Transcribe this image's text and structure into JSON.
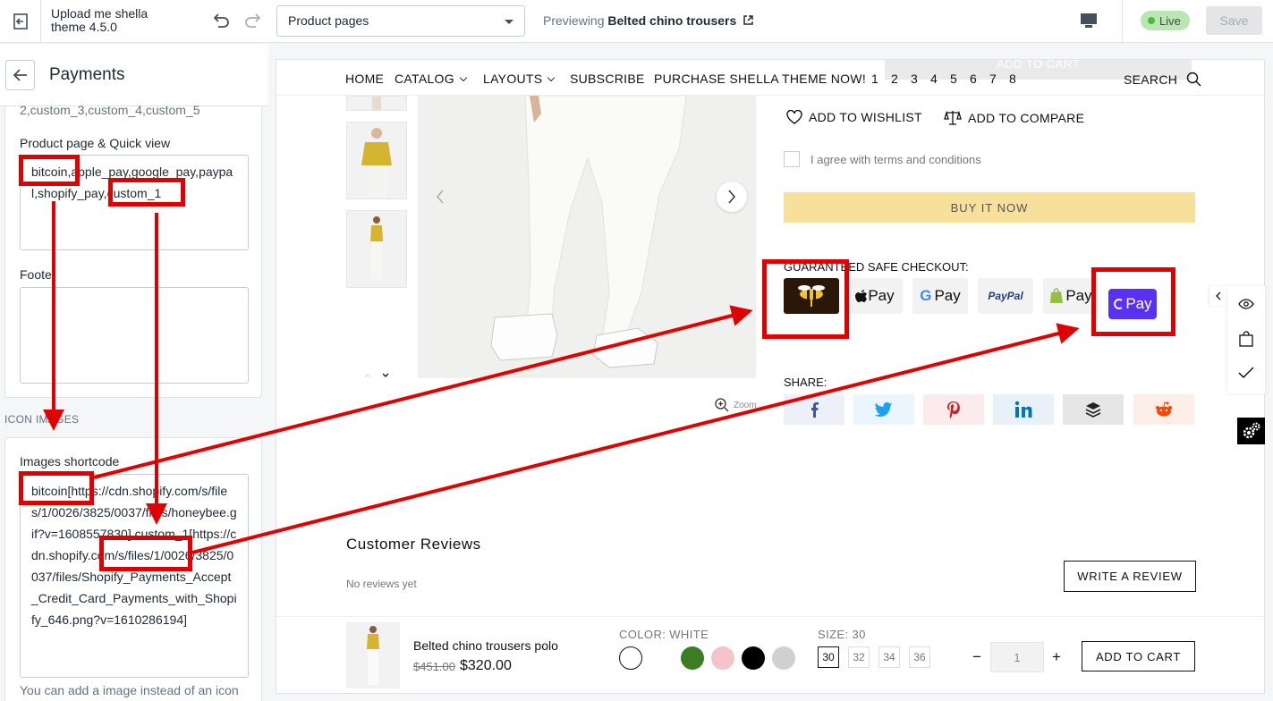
{
  "topbar": {
    "theme_name": "Upload me shella theme 4.5.0",
    "page_select": "Product pages",
    "previewing_prefix": "Previewing",
    "previewing_product": "Belted chino trousers",
    "live_label": "Live",
    "save_label": "Save"
  },
  "sidebar": {
    "title": "Payments",
    "cut_text": "2,custom_3,custom_4,custom_5",
    "product_label": "Product page & Quick view",
    "product_value": "bitcoin,apple_pay,google_pay,paypal,shopify_pay,custom_1",
    "footer_label": "Footer",
    "icon_images_heading": "ICON IMAGES",
    "shortcode_label": "Images shortcode",
    "shortcode_value": "bitcoin[https://cdn.shopify.com/s/files/1/0026/3825/0037/files/honeybee.gif?v=1608557830],custom_1[https://cdn.shopify.com/s/files/1/0026/3825/0037/files/Shopify_Payments_Accept_Credit_Card_Payments_with_Shopify_646.png?v=1610286194]",
    "help_text": "You can add a image instead of an icon"
  },
  "store": {
    "nav": [
      "HOME",
      "CATALOG",
      "LAYOUTS",
      "SUBSCRIBE",
      "PURCHASE SHELLA THEME NOW!",
      "1",
      "2",
      "3",
      "4",
      "5",
      "6",
      "7",
      "8"
    ],
    "search_label": "SEARCH",
    "ghost_cart": "ADD TO CART",
    "wishlist": "ADD TO WISHLIST",
    "compare": "ADD TO COMPARE",
    "terms": "I agree with terms and conditions",
    "buy_now": "BUY IT NOW",
    "safe_checkout": "GUARANTEED SAFE CHECKOUT:",
    "payments": [
      "bitcoin",
      "Pay",
      "Pay",
      "PayPal",
      "Pay",
      "Pay"
    ],
    "share_label": "SHARE:",
    "zoom_label": "Zoom",
    "reviews_title": "Customer Reviews",
    "no_reviews": "No reviews yet",
    "write_review": "WRITE A REVIEW"
  },
  "sticky": {
    "name": "Belted chino trousers polo",
    "old_price": "$451.00",
    "price": "$320.00",
    "color_label": "COLOR:",
    "color_value": "WHITE",
    "size_label": "SIZE:",
    "size_value": "30",
    "sizes": [
      "30",
      "32",
      "34",
      "36"
    ],
    "qty": "1",
    "minus": "−",
    "plus": "+",
    "add_to_cart": "ADD TO CART",
    "swatches": [
      "#ffffff",
      "#3a7d22",
      "#f4c3cc",
      "#000000",
      "#d0d0d0"
    ]
  },
  "colors": {
    "annotation": "#e00000",
    "live_bg": "#bbe5b3",
    "buy_now": "#f6e09c"
  }
}
